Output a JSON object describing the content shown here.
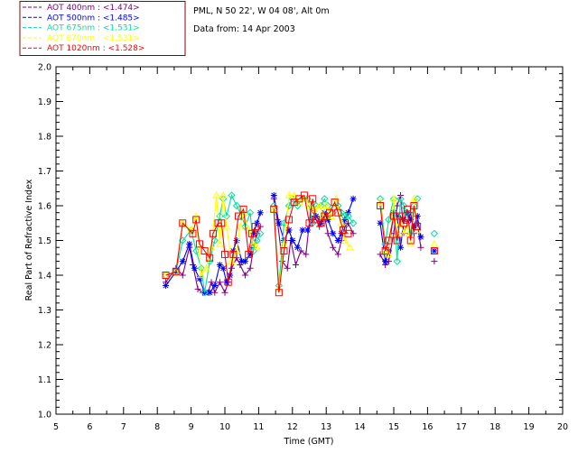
{
  "header": {
    "site_line": "PML, N 50 22', W 04 08', Alt 0m",
    "date_line": "Data from: 14 Apr 2003"
  },
  "chart_data": {
    "type": "line",
    "title": "",
    "xlabel": "Time (GMT)",
    "ylabel": "Real Part of Refractive Index",
    "xlim": [
      5,
      20
    ],
    "ylim": [
      1.0,
      2.0
    ],
    "xticks": [
      "5",
      "6",
      "7",
      "8",
      "9",
      "10",
      "11",
      "12",
      "13",
      "14",
      "15",
      "16",
      "17",
      "18",
      "19",
      "20"
    ],
    "yticks": [
      "1.0",
      "1.1",
      "1.2",
      "1.3",
      "1.4",
      "1.5",
      "1.6",
      "1.7",
      "1.8",
      "1.9",
      "2.0"
    ],
    "grid": false,
    "legend_position": "above-top-left",
    "series": [
      {
        "name": "AOT 400nm : <1.474>",
        "color": "#800080",
        "marker": "plus",
        "segments": [
          [
            [
              8.25,
              1.38
            ],
            [
              8.55,
              1.42
            ],
            [
              8.75,
              1.4
            ],
            [
              8.95,
              1.48
            ],
            [
              9.05,
              1.43
            ],
            [
              9.2,
              1.36
            ],
            [
              9.35,
              1.35
            ],
            [
              9.5,
              1.35
            ],
            [
              9.6,
              1.38
            ],
            [
              9.7,
              1.35
            ],
            [
              9.85,
              1.38
            ],
            [
              10.0,
              1.35
            ],
            [
              10.1,
              1.38
            ],
            [
              10.2,
              1.42
            ],
            [
              10.35,
              1.45
            ],
            [
              10.45,
              1.43
            ],
            [
              10.6,
              1.4
            ],
            [
              10.75,
              1.42
            ],
            [
              10.85,
              1.48
            ],
            [
              10.95,
              1.52
            ],
            [
              11.05,
              1.54
            ]
          ],
          [
            [
              11.45,
              1.62
            ],
            [
              11.55,
              1.56
            ],
            [
              11.7,
              1.44
            ],
            [
              11.85,
              1.42
            ],
            [
              11.95,
              1.5
            ],
            [
              12.1,
              1.43
            ],
            [
              12.25,
              1.47
            ],
            [
              12.4,
              1.46
            ],
            [
              12.55,
              1.6
            ],
            [
              12.65,
              1.57
            ],
            [
              12.8,
              1.54
            ],
            [
              12.95,
              1.57
            ],
            [
              13.05,
              1.52
            ],
            [
              13.2,
              1.48
            ],
            [
              13.35,
              1.46
            ],
            [
              13.45,
              1.5
            ],
            [
              13.55,
              1.54
            ],
            [
              13.65,
              1.55
            ],
            [
              13.8,
              1.52
            ]
          ],
          [
            [
              14.6,
              1.46
            ],
            [
              14.75,
              1.43
            ],
            [
              14.85,
              1.44
            ],
            [
              15.0,
              1.52
            ],
            [
              15.1,
              1.6
            ],
            [
              15.2,
              1.63
            ],
            [
              15.3,
              1.52
            ],
            [
              15.4,
              1.55
            ],
            [
              15.5,
              1.58
            ],
            [
              15.6,
              1.52
            ],
            [
              15.7,
              1.55
            ],
            [
              15.8,
              1.48
            ]
          ],
          [
            [
              16.2,
              1.44
            ]
          ]
        ]
      },
      {
        "name": "AOT 500nm : <1.485>",
        "color": "#0000ff",
        "marker": "asterisk",
        "segments": [
          [
            [
              8.25,
              1.37
            ],
            [
              8.55,
              1.41
            ],
            [
              8.75,
              1.44
            ],
            [
              8.95,
              1.49
            ],
            [
              9.1,
              1.42
            ],
            [
              9.25,
              1.39
            ],
            [
              9.4,
              1.35
            ],
            [
              9.55,
              1.35
            ],
            [
              9.7,
              1.37
            ],
            [
              9.85,
              1.43
            ],
            [
              9.95,
              1.42
            ],
            [
              10.05,
              1.38
            ],
            [
              10.15,
              1.4
            ],
            [
              10.25,
              1.47
            ],
            [
              10.35,
              1.5
            ],
            [
              10.5,
              1.44
            ],
            [
              10.6,
              1.44
            ],
            [
              10.75,
              1.46
            ],
            [
              10.85,
              1.52
            ],
            [
              10.95,
              1.55
            ],
            [
              11.05,
              1.58
            ]
          ],
          [
            [
              11.45,
              1.63
            ],
            [
              11.6,
              1.55
            ],
            [
              11.75,
              1.5
            ],
            [
              11.9,
              1.53
            ],
            [
              12.0,
              1.5
            ],
            [
              12.15,
              1.48
            ],
            [
              12.3,
              1.53
            ],
            [
              12.45,
              1.53
            ],
            [
              12.6,
              1.56
            ],
            [
              12.7,
              1.57
            ],
            [
              12.85,
              1.55
            ],
            [
              12.95,
              1.58
            ],
            [
              13.05,
              1.56
            ],
            [
              13.2,
              1.52
            ],
            [
              13.35,
              1.5
            ],
            [
              13.45,
              1.52
            ],
            [
              13.55,
              1.56
            ],
            [
              13.65,
              1.58
            ],
            [
              13.8,
              1.62
            ]
          ],
          [
            [
              14.6,
              1.55
            ],
            [
              14.75,
              1.44
            ],
            [
              14.85,
              1.47
            ],
            [
              15.0,
              1.58
            ],
            [
              15.1,
              1.57
            ],
            [
              15.2,
              1.48
            ],
            [
              15.3,
              1.56
            ],
            [
              15.4,
              1.58
            ],
            [
              15.5,
              1.56
            ],
            [
              15.6,
              1.54
            ],
            [
              15.7,
              1.57
            ],
            [
              15.8,
              1.51
            ]
          ],
          [
            [
              16.2,
              1.47
            ]
          ]
        ]
      },
      {
        "name": "AOT 675nm : <1.531>",
        "color": "#00e0a0",
        "marker": "diamond",
        "segments": [
          [
            [
              8.25,
              1.4
            ],
            [
              8.55,
              1.41
            ],
            [
              8.75,
              1.5
            ],
            [
              9.0,
              1.53
            ],
            [
              9.15,
              1.47
            ],
            [
              9.3,
              1.42
            ],
            [
              9.4,
              1.35
            ],
            [
              9.55,
              1.44
            ],
            [
              9.7,
              1.5
            ],
            [
              9.85,
              1.57
            ],
            [
              9.95,
              1.62
            ],
            [
              10.05,
              1.57
            ],
            [
              10.2,
              1.63
            ],
            [
              10.35,
              1.6
            ],
            [
              10.5,
              1.57
            ],
            [
              10.6,
              1.54
            ],
            [
              10.75,
              1.58
            ],
            [
              10.85,
              1.47
            ],
            [
              10.95,
              1.5
            ],
            [
              11.05,
              1.52
            ]
          ],
          [
            [
              11.45,
              1.6
            ],
            [
              11.6,
              1.37
            ],
            [
              11.75,
              1.55
            ],
            [
              11.9,
              1.6
            ],
            [
              12.0,
              1.62
            ],
            [
              12.15,
              1.6
            ],
            [
              12.3,
              1.62
            ],
            [
              12.45,
              1.62
            ],
            [
              12.6,
              1.55
            ],
            [
              12.7,
              1.6
            ],
            [
              12.85,
              1.6
            ],
            [
              12.95,
              1.62
            ],
            [
              13.05,
              1.6
            ],
            [
              13.2,
              1.58
            ],
            [
              13.35,
              1.6
            ],
            [
              13.45,
              1.58
            ],
            [
              13.55,
              1.57
            ],
            [
              13.65,
              1.57
            ],
            [
              13.8,
              1.55
            ]
          ],
          [
            [
              14.6,
              1.62
            ],
            [
              14.75,
              1.49
            ],
            [
              14.85,
              1.56
            ],
            [
              15.0,
              1.62
            ],
            [
              15.1,
              1.44
            ],
            [
              15.2,
              1.62
            ],
            [
              15.3,
              1.6
            ],
            [
              15.4,
              1.58
            ],
            [
              15.5,
              1.52
            ],
            [
              15.6,
              1.6
            ],
            [
              15.7,
              1.62
            ]
          ],
          [
            [
              16.2,
              1.52
            ]
          ]
        ]
      },
      {
        "name": "AOT 870nm : <1.531>",
        "color": "#ffff00",
        "marker": "triangle",
        "segments": [
          [
            [
              8.25,
              1.4
            ],
            [
              8.55,
              1.41
            ],
            [
              8.75,
              1.55
            ],
            [
              9.0,
              1.53
            ],
            [
              9.15,
              1.57
            ],
            [
              9.3,
              1.4
            ],
            [
              9.45,
              1.42
            ],
            [
              9.6,
              1.48
            ],
            [
              9.75,
              1.63
            ],
            [
              9.85,
              1.49
            ],
            [
              9.95,
              1.63
            ],
            [
              10.05,
              1.54
            ],
            [
              10.2,
              1.44
            ],
            [
              10.35,
              1.47
            ],
            [
              10.45,
              1.54
            ],
            [
              10.55,
              1.58
            ],
            [
              10.7,
              1.53
            ],
            [
              10.85,
              1.49
            ],
            [
              10.95,
              1.48
            ]
          ],
          [
            [
              11.45,
              1.59
            ],
            [
              11.6,
              1.36
            ],
            [
              11.75,
              1.49
            ],
            [
              11.9,
              1.63
            ],
            [
              12.05,
              1.63
            ],
            [
              12.2,
              1.61
            ],
            [
              12.35,
              1.62
            ],
            [
              12.5,
              1.6
            ],
            [
              12.65,
              1.59
            ],
            [
              12.8,
              1.6
            ],
            [
              12.9,
              1.57
            ],
            [
              13.0,
              1.6
            ],
            [
              13.15,
              1.57
            ],
            [
              13.3,
              1.62
            ],
            [
              13.45,
              1.55
            ],
            [
              13.55,
              1.5
            ],
            [
              13.7,
              1.48
            ]
          ],
          [
            [
              14.6,
              1.61
            ],
            [
              14.75,
              1.47
            ],
            [
              14.85,
              1.46
            ],
            [
              15.0,
              1.62
            ],
            [
              15.1,
              1.52
            ],
            [
              15.2,
              1.55
            ],
            [
              15.3,
              1.52
            ],
            [
              15.4,
              1.54
            ],
            [
              15.5,
              1.49
            ],
            [
              15.6,
              1.62
            ],
            [
              15.7,
              1.53
            ]
          ],
          [
            [
              16.2,
              1.49
            ]
          ]
        ]
      },
      {
        "name": "AOT 1020nm : <1.528>",
        "color": "#ff0000",
        "marker": "square",
        "segments": [
          [
            [
              8.25,
              1.4
            ],
            [
              8.55,
              1.41
            ],
            [
              8.75,
              1.55
            ],
            [
              9.05,
              1.52
            ],
            [
              9.15,
              1.56
            ],
            [
              9.25,
              1.49
            ],
            [
              9.4,
              1.47
            ],
            [
              9.55,
              1.45
            ],
            [
              9.65,
              1.52
            ],
            [
              9.8,
              1.55
            ],
            [
              9.9,
              1.55
            ],
            [
              10.0,
              1.46
            ],
            [
              10.1,
              1.38
            ],
            [
              10.25,
              1.46
            ],
            [
              10.4,
              1.57
            ],
            [
              10.55,
              1.59
            ],
            [
              10.7,
              1.46
            ],
            [
              10.8,
              1.52
            ],
            [
              10.9,
              1.54
            ]
          ],
          [
            [
              11.45,
              1.59
            ],
            [
              11.6,
              1.35
            ],
            [
              11.75,
              1.47
            ],
            [
              11.9,
              1.56
            ],
            [
              12.05,
              1.61
            ],
            [
              12.2,
              1.62
            ],
            [
              12.35,
              1.63
            ],
            [
              12.5,
              1.55
            ],
            [
              12.6,
              1.62
            ],
            [
              12.7,
              1.56
            ],
            [
              12.85,
              1.55
            ],
            [
              12.95,
              1.57
            ],
            [
              13.1,
              1.58
            ],
            [
              13.25,
              1.61
            ],
            [
              13.35,
              1.58
            ],
            [
              13.5,
              1.53
            ],
            [
              13.65,
              1.52
            ]
          ],
          [
            [
              14.6,
              1.6
            ],
            [
              14.75,
              1.47
            ],
            [
              14.85,
              1.5
            ],
            [
              15.0,
              1.57
            ],
            [
              15.1,
              1.5
            ],
            [
              15.2,
              1.57
            ],
            [
              15.3,
              1.55
            ],
            [
              15.4,
              1.59
            ],
            [
              15.5,
              1.5
            ],
            [
              15.6,
              1.6
            ],
            [
              15.7,
              1.54
            ]
          ],
          [
            [
              16.2,
              1.47
            ]
          ]
        ]
      }
    ]
  }
}
